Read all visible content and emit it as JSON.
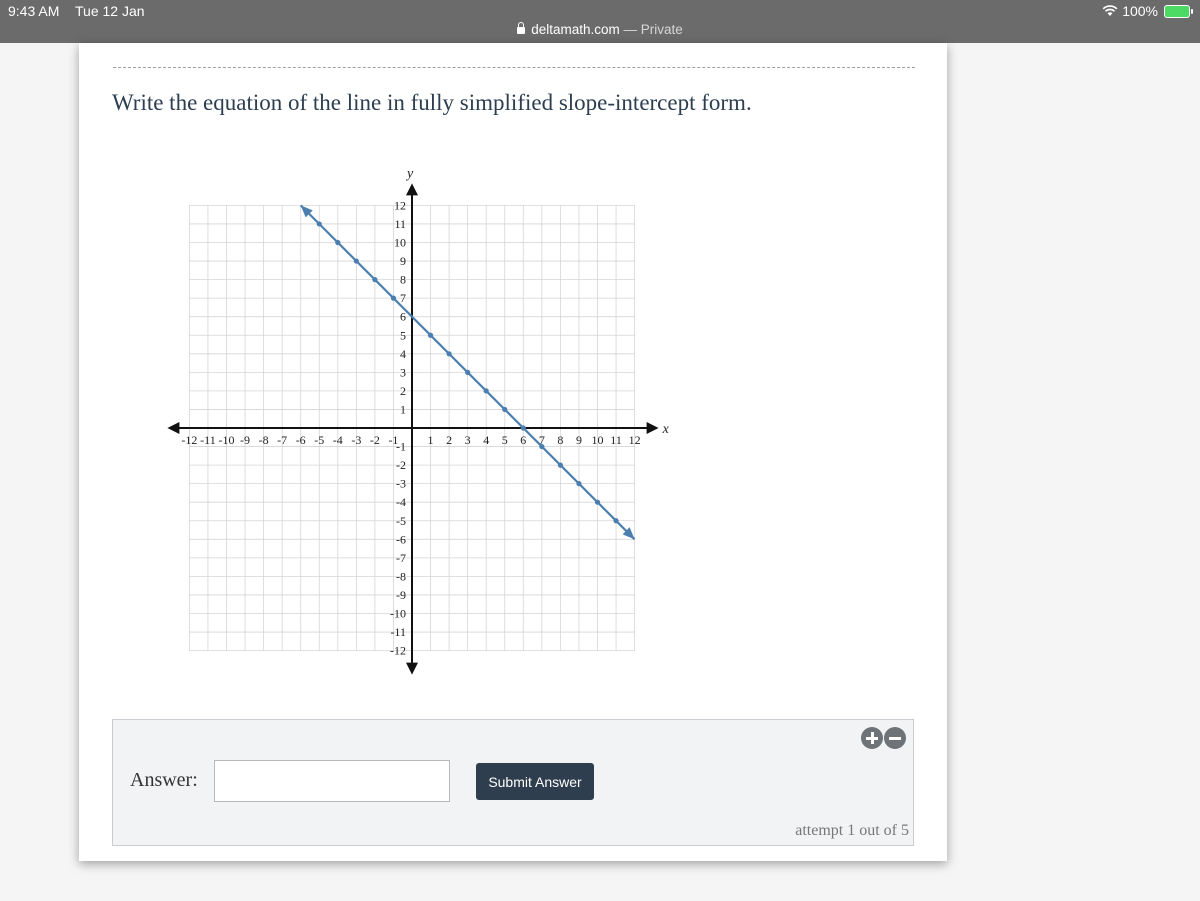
{
  "status_bar": {
    "time": "9:43 AM",
    "date": "Tue 12 Jan",
    "battery": "100%"
  },
  "address_bar": {
    "domain": "deltamath.com",
    "separator": " — ",
    "mode": "Private"
  },
  "question": {
    "text": "Write the equation of the line in fully simplified slope-intercept form."
  },
  "chart_data": {
    "type": "line",
    "xlabel": "x",
    "ylabel": "y",
    "xlim": [
      -12,
      12
    ],
    "ylim": [
      -12,
      12
    ],
    "grid": true,
    "x_ticks": [
      -12,
      -11,
      -10,
      -9,
      -8,
      -7,
      -6,
      -5,
      -4,
      -3,
      -2,
      -1,
      1,
      2,
      3,
      4,
      5,
      6,
      7,
      8,
      9,
      10,
      11,
      12
    ],
    "y_ticks": [
      -12,
      -11,
      -10,
      -9,
      -8,
      -7,
      -6,
      -5,
      -4,
      -3,
      -2,
      -1,
      1,
      2,
      3,
      4,
      5,
      6,
      7,
      8,
      9,
      10,
      11,
      12
    ],
    "line": {
      "x": [
        -6,
        12
      ],
      "y": [
        12,
        -6
      ]
    },
    "points": {
      "x": [
        -5,
        -4,
        -3,
        -2,
        -1,
        1,
        2,
        3,
        4,
        5,
        6,
        7,
        8,
        9,
        10,
        11
      ],
      "y": [
        11,
        10,
        9,
        8,
        7,
        5,
        4,
        3,
        2,
        1,
        0,
        -1,
        -2,
        -3,
        -4,
        -5
      ]
    },
    "line_color": "#4a7fb0"
  },
  "answer": {
    "label": "Answer:",
    "value": "",
    "submit_label": "Submit Answer",
    "attempt_text": "attempt 1 out of 5"
  },
  "colors": {
    "accent": "#2f3e4e",
    "line": "#4a7fb0"
  }
}
